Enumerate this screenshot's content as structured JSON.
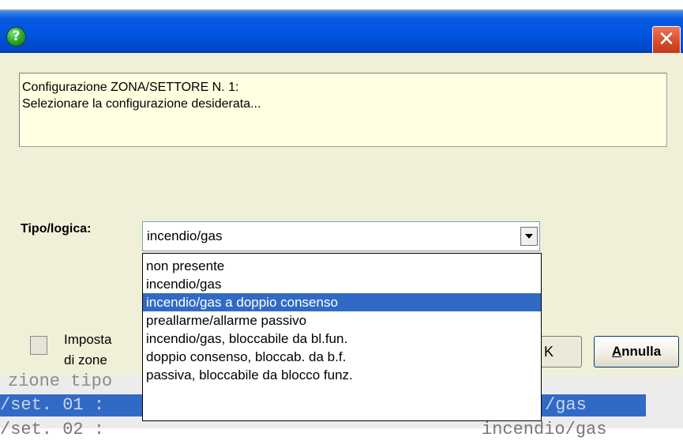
{
  "titlebar": {
    "icon": "help-icon",
    "close_label": "✕"
  },
  "message": {
    "line1": "Configurazione ZONA/SETTORE N.  1:",
    "line2": "Selezionare la configurazione desiderata..."
  },
  "tipo": {
    "label": "Tipo/logica:",
    "selected_value": "incendio/gas",
    "options": [
      "non presente",
      "incendio/gas",
      "incendio/gas a doppio consenso",
      "preallarme/allarme passivo",
      "incendio/gas, bloccabile da bl.fun.",
      "doppio consenso, bloccab. da b.f.",
      "passiva, bloccabile da blocco funz."
    ],
    "highlighted_index": 2
  },
  "imposta": {
    "line1": "Imposta",
    "line2": "di zone"
  },
  "buttons": {
    "ok_label": "K",
    "annulla_label": "Annulla",
    "annulla_mnemonic": "A",
    "annulla_rest": "nnulla"
  },
  "console": {
    "row1": "zione tipo",
    "row2_left": "/set. 01 :",
    "row2_right": "/gas",
    "row3_left": "/set. 02 :",
    "row3_right": "incendio/gas"
  },
  "colors": {
    "titlebar": "#0054e3",
    "client_bg": "#f0f0d9",
    "message_bg": "#ffffe1",
    "selection": "#316ac5",
    "close": "#d9502d"
  }
}
